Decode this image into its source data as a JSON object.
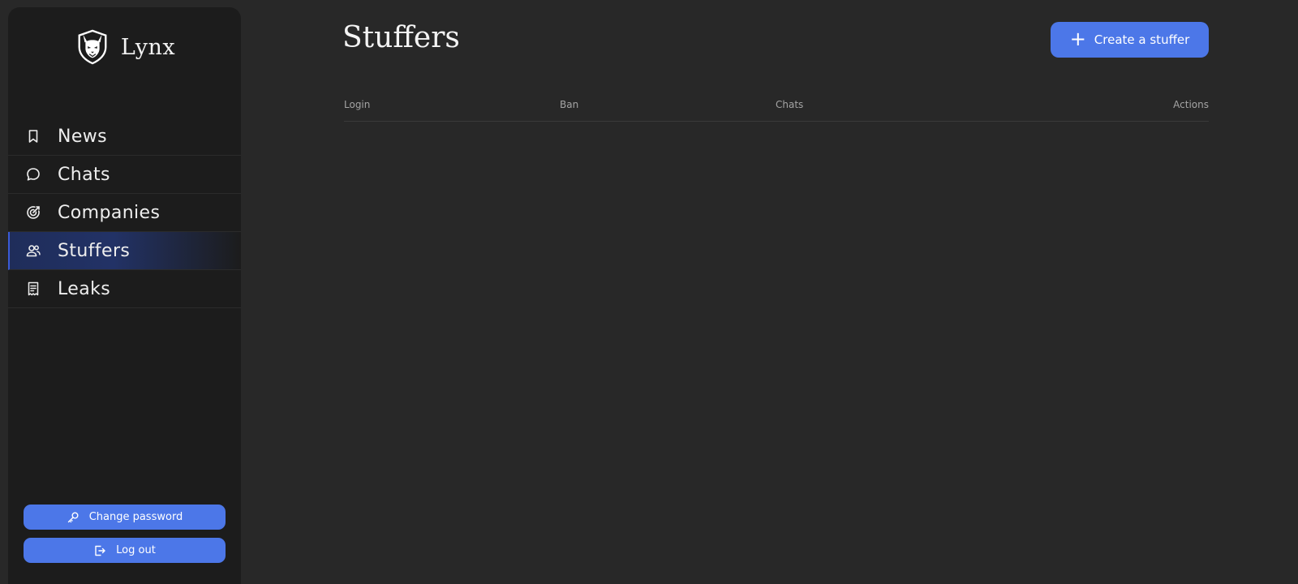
{
  "brand": {
    "name": "Lynx",
    "logo_icon": "lynx-shield-logo"
  },
  "sidebar": {
    "items": [
      {
        "label": "News",
        "icon": "bookmark-icon",
        "active": false
      },
      {
        "label": "Chats",
        "icon": "chat-bubble-icon",
        "active": false
      },
      {
        "label": "Companies",
        "icon": "target-icon",
        "active": false
      },
      {
        "label": "Stuffers",
        "icon": "users-icon",
        "active": true
      },
      {
        "label": "Leaks",
        "icon": "receipt-icon",
        "active": false
      }
    ],
    "change_password_label": "Change password",
    "logout_label": "Log out"
  },
  "main": {
    "title": "Stuffers",
    "create_button_label": "Create a stuffer",
    "table": {
      "columns": [
        "Login",
        "Ban",
        "Chats",
        "Actions"
      ],
      "rows": []
    }
  },
  "colors": {
    "background": "#282828",
    "sidebar": "#1c1c1c",
    "accent": "#4c77e8",
    "active_nav": "#223266"
  }
}
